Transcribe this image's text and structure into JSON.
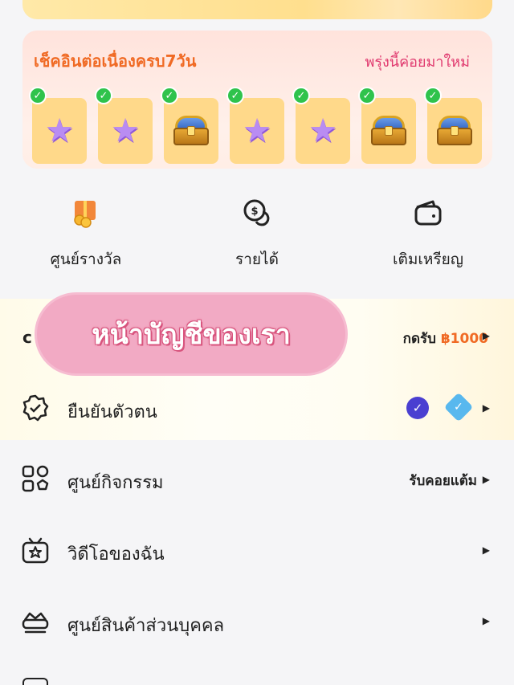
{
  "checkin": {
    "title": "เช็คอินต่อเนื่องครบ7วัน",
    "tomorrow": "พรุ่งนี้ค่อยมาใหม่",
    "days": [
      {
        "reward": "star-icon",
        "checked": true
      },
      {
        "reward": "star-icon",
        "checked": true
      },
      {
        "reward": "treasure-chest-icon",
        "checked": true
      },
      {
        "reward": "star-icon",
        "checked": true
      },
      {
        "reward": "star-icon",
        "checked": true
      },
      {
        "reward": "treasure-chest-icon",
        "checked": true
      },
      {
        "reward": "treasure-chest-icon",
        "checked": true
      }
    ]
  },
  "quick_actions": [
    {
      "label": "ศูนย์รางวัล",
      "icon": "reward-center-icon"
    },
    {
      "label": "รายได้",
      "icon": "coin-income-icon"
    },
    {
      "label": "เติมเหรียญ",
      "icon": "wallet-icon"
    }
  ],
  "sticker_text": "หน้าบัญชีของเรา",
  "account_row": {
    "prefix": "c",
    "right_label": "กดรับ",
    "right_amount": "฿1000"
  },
  "menu": [
    {
      "label": "ยืนยันตัวตน",
      "icon": "verify-badge-icon",
      "right": ""
    },
    {
      "label": "ศูนย์กิจกรรม",
      "icon": "activity-grid-icon",
      "right": "รับคอยแต้ม"
    },
    {
      "label": "วิดีโอของฉัน",
      "icon": "tv-icon",
      "right": ""
    },
    {
      "label": "ศูนย์สินค้าส่วนบุคคล",
      "icon": "crown-shop-icon",
      "right": ""
    }
  ],
  "colors": {
    "accent_orange": "#f06a24",
    "accent_pink": "#e0386e",
    "check_green": "#2fc34c",
    "sticker_pink": "#f2aac4"
  }
}
